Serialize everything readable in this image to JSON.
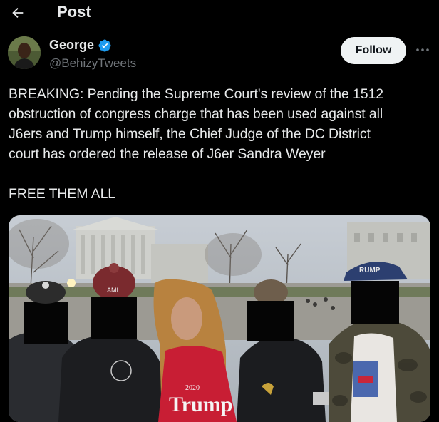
{
  "header": {
    "title": "Post"
  },
  "author": {
    "name": "George",
    "handle": "@BehizyTweets",
    "follow_label": "Follow"
  },
  "tweet": {
    "text_lines": [
      "BREAKING: Pending the Supreme Court's review of the 1512",
      "obstruction of congress charge that has been used against all",
      "J6ers and Trump himself, the Chief Judge of the DC District",
      "court has ordered the release of J6er Sandra Weyer"
    ],
    "closing": "FREE THEM ALL"
  },
  "photo": {
    "hat_text_left": "AMI",
    "hat_text_right": "RUMP",
    "shirt_year": "2020",
    "shirt_text": "Trump"
  },
  "colors": {
    "background": "#000000",
    "text": "#e7e9ea",
    "muted": "#71767b",
    "verified": "#1d9bf0",
    "follow_bg": "#eff3f4"
  }
}
